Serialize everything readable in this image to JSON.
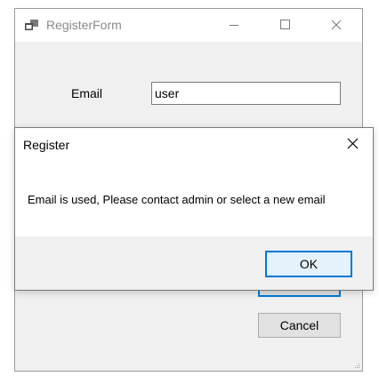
{
  "main_window": {
    "title": "RegisterForm",
    "icon": "app-window-icon",
    "controls": {
      "minimize_icon": "minimize-icon",
      "maximize_icon": "maximize-icon",
      "close_icon": "close-icon"
    },
    "form": {
      "email_label": "Email",
      "email_value": "user",
      "cancel_label": "Cancel"
    }
  },
  "dialog": {
    "title": "Register",
    "message": "Email is used, Please contact admin or select a new email",
    "ok_label": "OK",
    "close_icon": "close-icon"
  },
  "colors": {
    "accent": "#0078d7",
    "window_bg": "#f0f0f0",
    "button_bg": "#e1e1e1",
    "title_inactive": "#8a8a8a"
  }
}
